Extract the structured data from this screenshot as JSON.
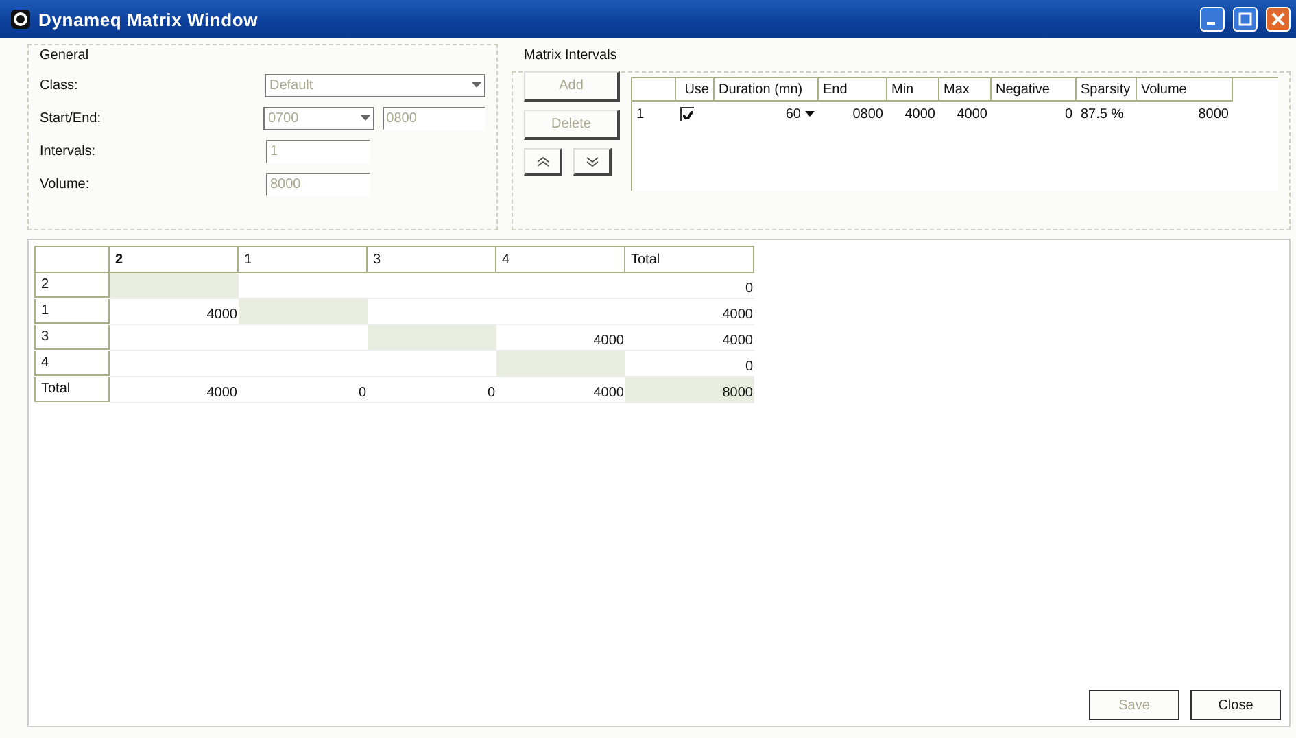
{
  "window": {
    "title": "Dynameq  Matrix Window"
  },
  "general": {
    "title": "General",
    "fields": [
      {
        "label": "Class:",
        "kind": "dropdown",
        "value": "Default",
        "disabled": true
      },
      {
        "label": "Start/End:",
        "kind": "range",
        "value": "0700",
        "value2": "0800",
        "disabled": true
      },
      {
        "label": "Intervals:",
        "kind": "text",
        "value": "1",
        "disabled": true
      },
      {
        "label": "Volume:",
        "kind": "text",
        "value": "8000",
        "disabled": true
      }
    ]
  },
  "matrix_intervals": {
    "title": "Matrix Intervals",
    "buttons": [
      {
        "label": "Add",
        "disabled": true
      },
      {
        "label": "Delete",
        "disabled": true
      }
    ],
    "move_buttons": [
      {
        "kind": "up"
      },
      {
        "kind": "down"
      }
    ],
    "columns": [
      "Use",
      "Duration (mn)",
      "End",
      "Min",
      "Max",
      "Negative",
      "Sparsity",
      "Volume"
    ],
    "rows": [
      {
        "index": "1",
        "checked": true,
        "duration": "60",
        "end": "0800",
        "min": "4000",
        "max": "4000",
        "negative": "0",
        "sparsity": "87.5 %",
        "volume": "8000"
      }
    ]
  },
  "matrix": {
    "columns": [
      "2",
      "1",
      "3",
      "4",
      "Total"
    ],
    "rows": [
      {
        "label": "2",
        "cells": [
          {
            "shaded": true
          },
          {
            "shaded": false
          },
          {
            "shaded": false
          },
          {
            "shaded": false
          },
          {
            "text": "0",
            "shaded": false
          }
        ]
      },
      {
        "label": "1",
        "cells": [
          {
            "text": "4000",
            "shaded": false
          },
          {
            "shaded": true
          },
          {
            "shaded": false
          },
          {
            "shaded": false
          },
          {
            "text": "4000",
            "shaded": false
          }
        ]
      },
      {
        "label": "3",
        "cells": [
          {
            "shaded": false
          },
          {
            "shaded": false
          },
          {
            "shaded": true
          },
          {
            "text": "4000",
            "shaded": false
          },
          {
            "text": "4000",
            "shaded": false
          }
        ]
      },
      {
        "label": "4",
        "cells": [
          {
            "shaded": false
          },
          {
            "shaded": false
          },
          {
            "shaded": false
          },
          {
            "shaded": true
          },
          {
            "text": "0",
            "shaded": false
          }
        ]
      },
      {
        "label": "Total",
        "cells": [
          {
            "text": "4000",
            "shaded": false
          },
          {
            "text": "0",
            "shaded": false
          },
          {
            "text": "0",
            "shaded": false
          },
          {
            "text": "4000",
            "shaded": false
          },
          {
            "text": "8000",
            "shaded": true
          }
        ]
      }
    ]
  },
  "footer_buttons": [
    {
      "label": "Save",
      "disabled": true
    },
    {
      "label": "Close",
      "disabled": false
    }
  ]
}
